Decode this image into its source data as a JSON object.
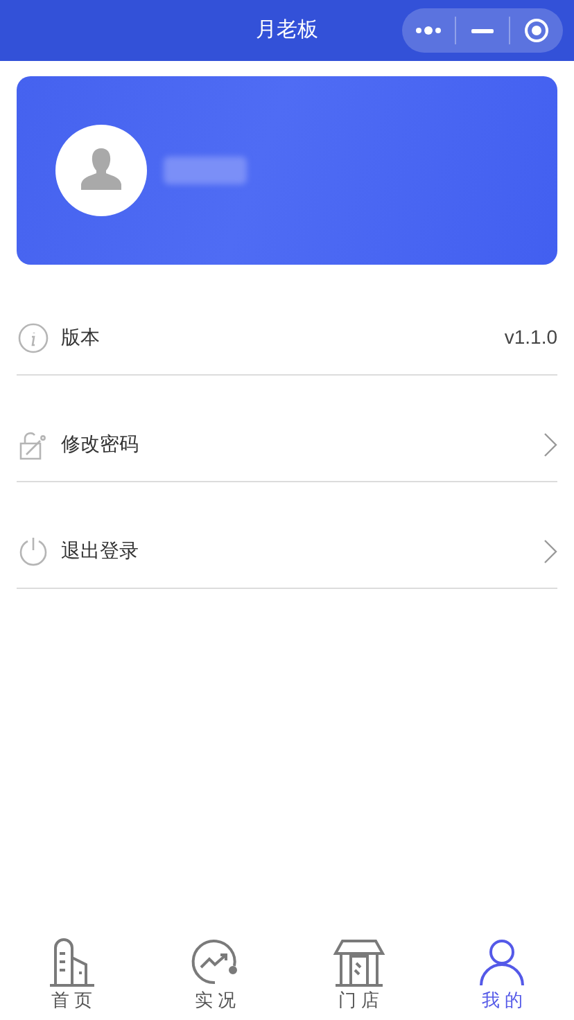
{
  "nav_bar": {
    "title": "月老板"
  },
  "menu": [
    {
      "kind": "info",
      "label": "版本",
      "value": "v1.1.0"
    },
    {
      "kind": "link",
      "label": "修改密码"
    },
    {
      "kind": "link",
      "label": "退出登录"
    }
  ],
  "tab_bar": [
    {
      "label": "首 页",
      "selected": false
    },
    {
      "label": "实 况",
      "selected": false
    },
    {
      "label": "门 店",
      "selected": false
    },
    {
      "label": "我 的",
      "selected": true
    }
  ]
}
